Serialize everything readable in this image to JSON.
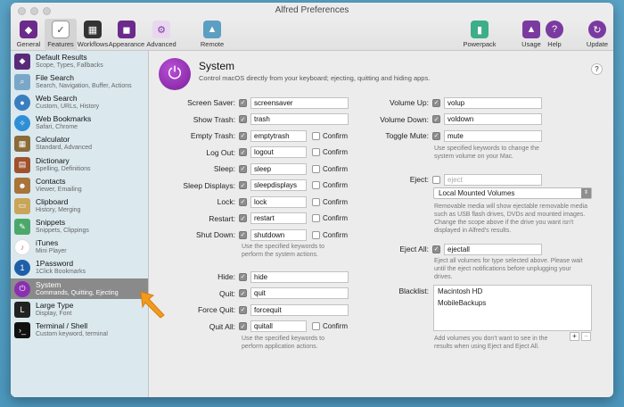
{
  "window": {
    "title": "Alfred Preferences"
  },
  "toolbar": {
    "items": [
      {
        "label": "General",
        "color": "#6b2a8c"
      },
      {
        "label": "Features",
        "color": "#4a4a4a"
      },
      {
        "label": "Workflows",
        "color": "#333333"
      },
      {
        "label": "Appearance",
        "color": "#6b2a8c"
      },
      {
        "label": "Advanced",
        "color": "#9a5fb0"
      },
      {
        "label": "Remote",
        "color": "#5b9fc2"
      },
      {
        "label": "Powerpack",
        "color": "#3cae8a"
      },
      {
        "label": "Usage",
        "color": "#7b3aa0"
      },
      {
        "label": "Help",
        "color": "#7b3aa0"
      },
      {
        "label": "Update",
        "color": "#7b3aa0"
      }
    ]
  },
  "sidebar": {
    "items": [
      {
        "title": "Default Results",
        "sub": "Scope, Types, Fallbacks",
        "color": "#5a2a7a"
      },
      {
        "title": "File Search",
        "sub": "Search, Navigation, Buffer, Actions",
        "color": "#7aa7c7"
      },
      {
        "title": "Web Search",
        "sub": "Custom, URLs, History",
        "color": "#3a7ebf"
      },
      {
        "title": "Web Bookmarks",
        "sub": "Safari, Chrome",
        "color": "#2f8fd6"
      },
      {
        "title": "Calculator",
        "sub": "Standard, Advanced",
        "color": "#8a6b3a"
      },
      {
        "title": "Dictionary",
        "sub": "Spelling, Definitions",
        "color": "#a0522d"
      },
      {
        "title": "Contacts",
        "sub": "Viewer, Emailing",
        "color": "#a8743a"
      },
      {
        "title": "Clipboard",
        "sub": "History, Merging",
        "color": "#c9a55a"
      },
      {
        "title": "Snippets",
        "sub": "Snippets, Clippings",
        "color": "#4ca86a"
      },
      {
        "title": "iTunes",
        "sub": "Mini Player",
        "color": "#e05a8a"
      },
      {
        "title": "1Password",
        "sub": "1Click Bookmarks",
        "color": "#1f5fa8"
      },
      {
        "title": "System",
        "sub": "Commands, Quitting, Ejecting",
        "color": "#8a2fb0"
      },
      {
        "title": "Large Type",
        "sub": "Display, Font",
        "color": "#222222"
      },
      {
        "title": "Terminal / Shell",
        "sub": "Custom keyword, terminal",
        "color": "#111111"
      }
    ]
  },
  "main": {
    "title": "System",
    "description": "Control macOS directly from your keyboard; ejecting, quitting and hiding apps.",
    "help": "?",
    "confirm_label": "Confirm",
    "left_commands": [
      {
        "label": "Screen Saver:",
        "value": "screensaver",
        "confirm": false
      },
      {
        "label": "Show Trash:",
        "value": "trash",
        "confirm": false
      },
      {
        "label": "Empty Trash:",
        "value": "emptytrash",
        "confirm": true
      },
      {
        "label": "Log Out:",
        "value": "logout",
        "confirm": true
      },
      {
        "label": "Sleep:",
        "value": "sleep",
        "confirm": true
      },
      {
        "label": "Sleep Displays:",
        "value": "sleepdisplays",
        "confirm": true
      },
      {
        "label": "Lock:",
        "value": "lock",
        "confirm": true
      },
      {
        "label": "Restart:",
        "value": "restart",
        "confirm": true
      },
      {
        "label": "Shut Down:",
        "value": "shutdown",
        "confirm": true
      }
    ],
    "system_hint": "Use the specified keywords to perform the system actions.",
    "app_commands": [
      {
        "label": "Hide:",
        "value": "hide",
        "confirm": false
      },
      {
        "label": "Quit:",
        "value": "quit",
        "confirm": false
      },
      {
        "label": "Force Quit:",
        "value": "forcequit",
        "confirm": false
      },
      {
        "label": "Quit All:",
        "value": "quitall",
        "confirm": true
      }
    ],
    "app_hint": "Use the specified keywords to perform application actions.",
    "volume": [
      {
        "label": "Volume Up:",
        "value": "volup"
      },
      {
        "label": "Volume Down:",
        "value": "voldown"
      },
      {
        "label": "Toggle Mute:",
        "value": "mute"
      }
    ],
    "volume_hint": "Use specified keywords to change the system volume on your Mac.",
    "eject": {
      "label": "Eject:",
      "value": "eject"
    },
    "eject_scope": "Local Mounted Volumes",
    "eject_hint": "Removable media will show ejectable removable media such as USB flash drives, DVDs and mounted images. Change the scope above if the drive you want isn't displayed in Alfred's results.",
    "eject_all": {
      "label": "Eject All:",
      "value": "ejectall"
    },
    "eject_all_hint": "Eject all volumes for type selected above. Please wait until the eject notifications before unplugging your drives.",
    "blacklist_label": "Blacklist:",
    "blacklist": [
      "Macintosh HD",
      "MobileBackups"
    ],
    "blacklist_hint": "Add volumes you don't want to see in the results when using Eject and Eject All.",
    "add_button": "+",
    "remove_button": "−"
  }
}
